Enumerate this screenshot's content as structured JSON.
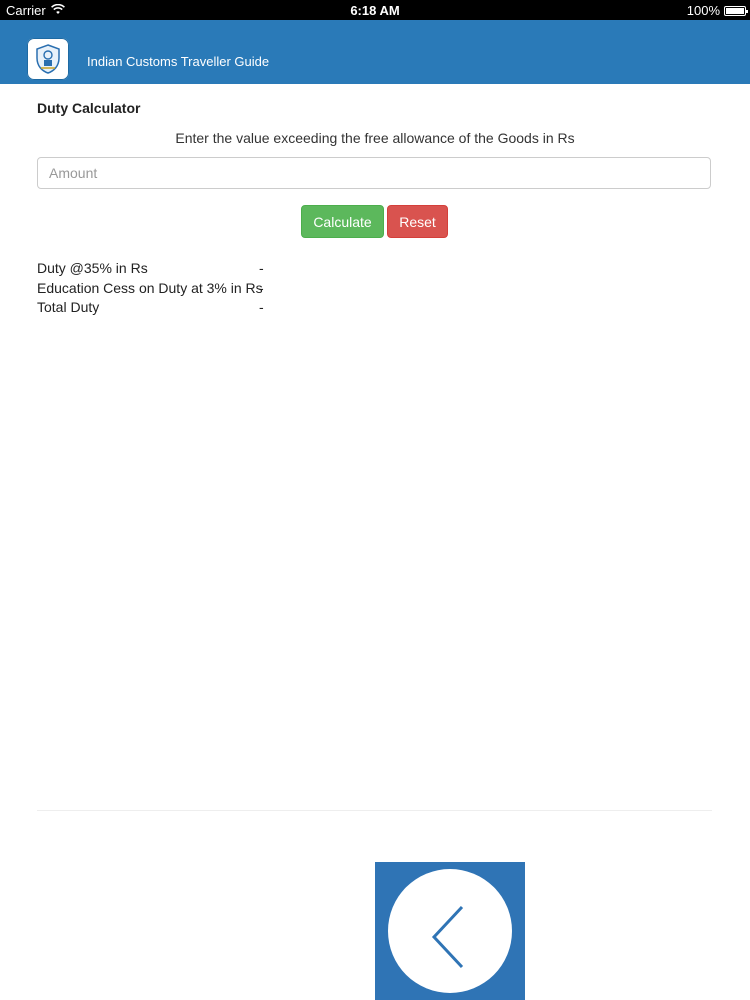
{
  "status_bar": {
    "carrier": "Carrier",
    "wifi_icon": "wifi-icon",
    "time": "6:18 AM",
    "battery": "100%",
    "battery_icon": "battery-icon"
  },
  "header": {
    "title": "Indian Customs Traveller Guide",
    "logo_icon": "customs-emblem-icon",
    "background_color": "#2a7ab8"
  },
  "calculator": {
    "title": "Duty Calculator",
    "instruction": "Enter the value exceeding the free allowance of the Goods in Rs",
    "amount_placeholder": "Amount",
    "amount_value": "",
    "calculate_label": "Calculate",
    "reset_label": "Reset",
    "calculate_color": "#5cb85c",
    "reset_color": "#d9534f"
  },
  "results": [
    {
      "label": "Duty @35% in Rs",
      "value": "-"
    },
    {
      "label": "Education Cess on Duty at 3% in Rs",
      "value": "-"
    },
    {
      "label": "Total Duty",
      "value": "-"
    }
  ],
  "footer": {
    "back_icon": "chevron-left-icon",
    "tile_color": "#2f74b5"
  }
}
